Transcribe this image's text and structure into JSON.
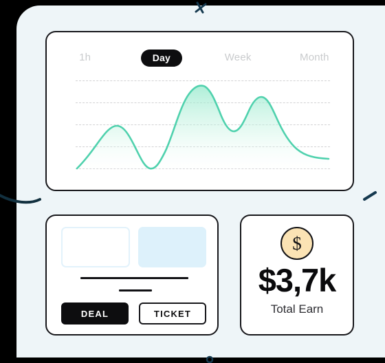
{
  "theme": {
    "page_background": "#000000",
    "panel_background": "#eef5f8",
    "card_background": "#ffffff",
    "card_border": "#16161a",
    "accent_green": "#4fd1ad",
    "accent_green_fill": "#d9f7ec",
    "accent_blue": "#ddf1fb",
    "coin_gold": "#fbe3b4",
    "active_tab_background": "#0d0d0f",
    "inactive_tab_text": "#c9cbcd",
    "deco_navy": "#15394f"
  },
  "chart_card": {
    "tabs": [
      {
        "label": "1h",
        "active": false
      },
      {
        "label": "Day",
        "active": true
      },
      {
        "label": "Week",
        "active": false
      },
      {
        "label": "Month",
        "active": false
      }
    ]
  },
  "chart_data": {
    "type": "area",
    "title": "",
    "subtitle": "",
    "xlabel": "",
    "ylabel": "",
    "grid": true,
    "gridlines": 5,
    "legend": "none",
    "series": [
      {
        "name": "Day",
        "color": "#4fd1ad",
        "fill": "#d9f7ec",
        "x": [
          0,
          5,
          10,
          15,
          20,
          25,
          30,
          35,
          40,
          45,
          50,
          55,
          60,
          65,
          70,
          75,
          80,
          85,
          90,
          95,
          100
        ],
        "values": [
          4,
          12,
          25,
          38,
          45,
          41,
          30,
          17,
          11,
          13,
          27,
          50,
          72,
          86,
          90,
          82,
          70,
          66,
          72,
          80,
          82
        ]
      }
    ],
    "x": [
      0,
      5,
      10,
      15,
      20,
      25,
      30,
      35,
      40,
      45,
      50,
      55,
      60,
      65,
      70,
      75,
      80,
      85,
      90,
      95,
      100
    ],
    "values": [
      4,
      12,
      25,
      38,
      45,
      41,
      30,
      17,
      11,
      13,
      27,
      50,
      72,
      86,
      90,
      82,
      70,
      66,
      72,
      80,
      82
    ],
    "xlim": [
      0,
      100
    ],
    "ylim": [
      0,
      100
    ],
    "tail_values": [
      75,
      58,
      40,
      28,
      22,
      20,
      20,
      20
    ]
  },
  "deal_card": {
    "thumbnail_a": "",
    "thumbnail_b": "",
    "rule_long": "",
    "rule_short": "",
    "primary_button": "DEAL",
    "secondary_button": "TICKET"
  },
  "earn_card": {
    "coin_icon": "dollar-coin-icon",
    "coin_glyph": "$",
    "amount": "$3,7k",
    "label": "Total Earn"
  },
  "decorations": {
    "top_sparkle": "sparkle-cross-icon",
    "left_arc": "arc-swoosh-icon",
    "right_dash": "diagonal-dash-icon",
    "bottom_dot": "ring-dot-icon"
  }
}
